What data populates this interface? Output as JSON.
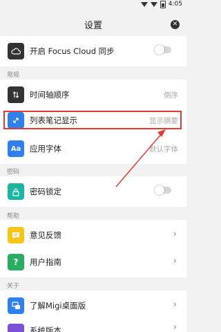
{
  "status_bar": {
    "time": "4:05"
  },
  "header": {
    "title": "设置"
  },
  "sections": {
    "general": "常规",
    "password": "密码",
    "help": "帮助",
    "about": "关于"
  },
  "items": {
    "cloud_sync": {
      "label": "开启 Focus Cloud 同步",
      "icon": "cloud-icon"
    },
    "timeline_order": {
      "label": "时间轴顺序",
      "value": "倒序",
      "icon": "sort-icon"
    },
    "note_display": {
      "label": "列表笔记显示",
      "value": "显示摘要",
      "icon": "expand-icon"
    },
    "app_font": {
      "label": "应用字体",
      "value": "默认字体",
      "icon": "font-icon",
      "icon_text": "Aa"
    },
    "password_lock": {
      "label": "密码锁定",
      "icon": "lock-icon"
    },
    "feedback": {
      "label": "意见反馈",
      "icon": "feedback-icon"
    },
    "user_guide": {
      "label": "用户指南",
      "icon": "question-icon",
      "icon_text": "?"
    },
    "about_app": {
      "label": "了解Migi桌面版",
      "icon": "desktop-icon"
    },
    "partial_next": {
      "label": "系统版本"
    }
  },
  "colors": {
    "highlight": "#e53935",
    "icon_dark": "#333333",
    "icon_blue": "#2f80ed",
    "icon_yellow": "#f5c518",
    "icon_green": "#27ae60",
    "icon_purple": "#7b4fd6",
    "icon_lock": "#1bb5a3"
  }
}
